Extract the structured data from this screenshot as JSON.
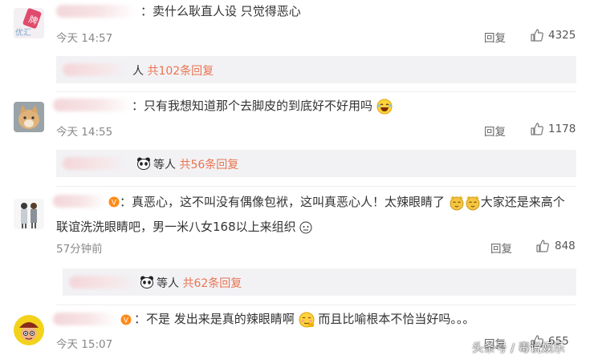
{
  "comments": [
    {
      "text": "：卖什么耿直人设 只觉得恶心",
      "time": "今天 14:57",
      "reply_label": "回复",
      "likes": "4325",
      "avatar_badge": "牌",
      "sub": {
        "prefix": "人 ",
        "link": "共102条回复"
      }
    },
    {
      "text": "：只有我想知道那个去脚皮的到底好不好用吗",
      "time": "今天 14:55",
      "reply_label": "回复",
      "likes": "1178",
      "sub": {
        "prefix": "等人 ",
        "link": "共56条回复"
      }
    },
    {
      "text_line1a": "：真恶心，这不叫没有偶像包袱，这叫真恶心人！太辣眼睛了",
      "text_line1b": "大家还是来高个",
      "text_line2": "联谊洗洗眼睛吧，男一米八女168以上来组织",
      "time": "57分钟前",
      "reply_label": "回复",
      "likes": "848",
      "sub": {
        "prefix": "等人 ",
        "link": "共62条回复"
      }
    },
    {
      "text_a": "：不是 发出来是真的辣眼睛啊",
      "text_b": " 而且比喻根本不恰当好吗。。。",
      "time": "今天 15:07",
      "reply_label": "回复",
      "likes": "655"
    }
  ],
  "colors": {
    "link": "#eb7350",
    "subbox_bg": "#f2f2f5",
    "meta": "#888888"
  },
  "icons": [
    "thumbs-up-icon",
    "laughing-emoji-icon",
    "panda-icon",
    "cat-face-emoji-icon",
    "embarrassed-emoji-icon",
    "vip-badge-icon"
  ],
  "watermark": "头条号 / 毒说娱乐"
}
